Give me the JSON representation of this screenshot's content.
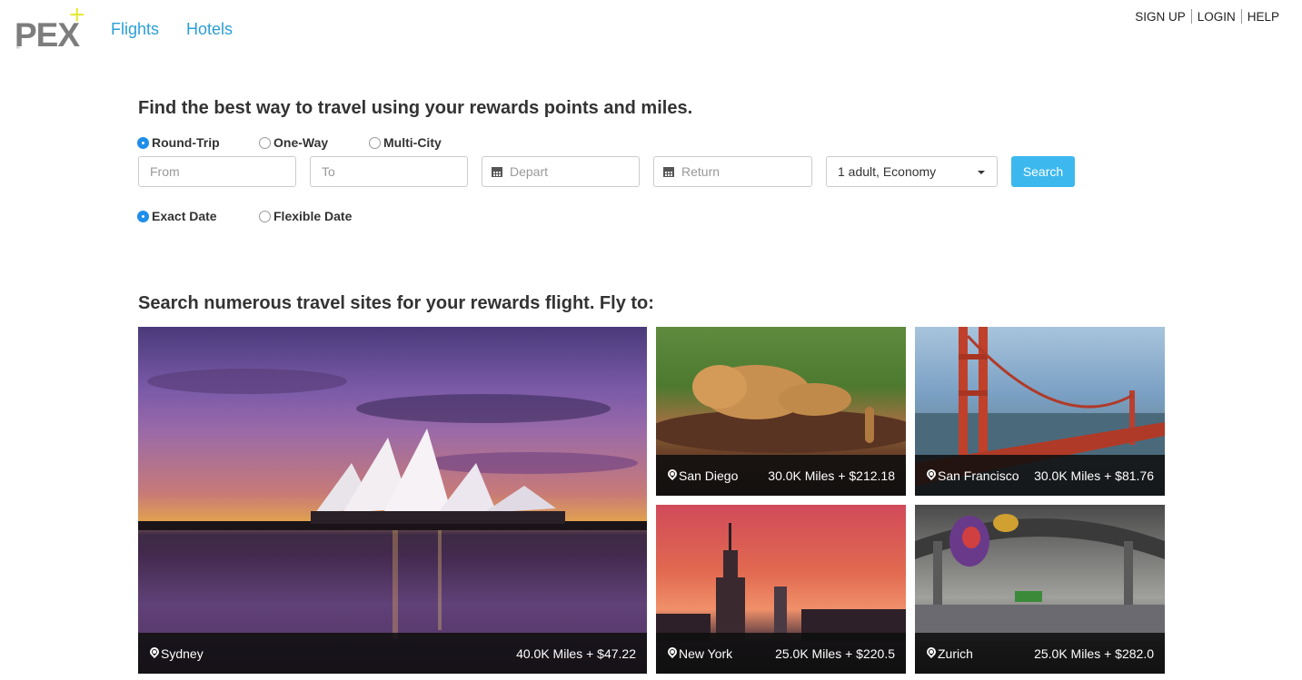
{
  "header": {
    "logo_text": "PEX",
    "logo_tm": "™",
    "nav": [
      {
        "label": "Flights"
      },
      {
        "label": "Hotels"
      }
    ],
    "account_links": [
      {
        "label": "SIGN UP"
      },
      {
        "label": "LOGIN"
      },
      {
        "label": "HELP"
      }
    ]
  },
  "search": {
    "headline": "Find the best way to travel using your rewards points and miles.",
    "trip_types": [
      {
        "label": "Round-Trip",
        "selected": true
      },
      {
        "label": "One-Way",
        "selected": false
      },
      {
        "label": "Multi-City",
        "selected": false
      }
    ],
    "from_placeholder": "From",
    "to_placeholder": "To",
    "depart_placeholder": "Depart",
    "return_placeholder": "Return",
    "passengers_value": "1 adult, Economy",
    "search_label": "Search",
    "date_modes": [
      {
        "label": "Exact Date",
        "selected": true
      },
      {
        "label": "Flexible Date",
        "selected": false
      }
    ]
  },
  "destinations": {
    "headline": "Search numerous travel sites for your rewards flight. Fly to:",
    "items": [
      {
        "city": "Sydney",
        "price": "40.0K Miles + $47.22"
      },
      {
        "city": "San Diego",
        "price": "30.0K Miles + $212.18"
      },
      {
        "city": "San Francisco",
        "price": "30.0K Miles + $81.76"
      },
      {
        "city": "New York",
        "price": "25.0K Miles + $220.5"
      },
      {
        "city": "Zurich",
        "price": "25.0K Miles + $282.0"
      }
    ]
  },
  "colors": {
    "link_blue": "#2a9fd6",
    "search_button": "#3cb8ee",
    "radio_selected": "#1f8ee8",
    "logo_gray": "#7d7d7d",
    "logo_plus": "#e4ea3a"
  },
  "icons": [
    "calendar-icon",
    "map-pin-icon",
    "chevron-down-icon"
  ]
}
